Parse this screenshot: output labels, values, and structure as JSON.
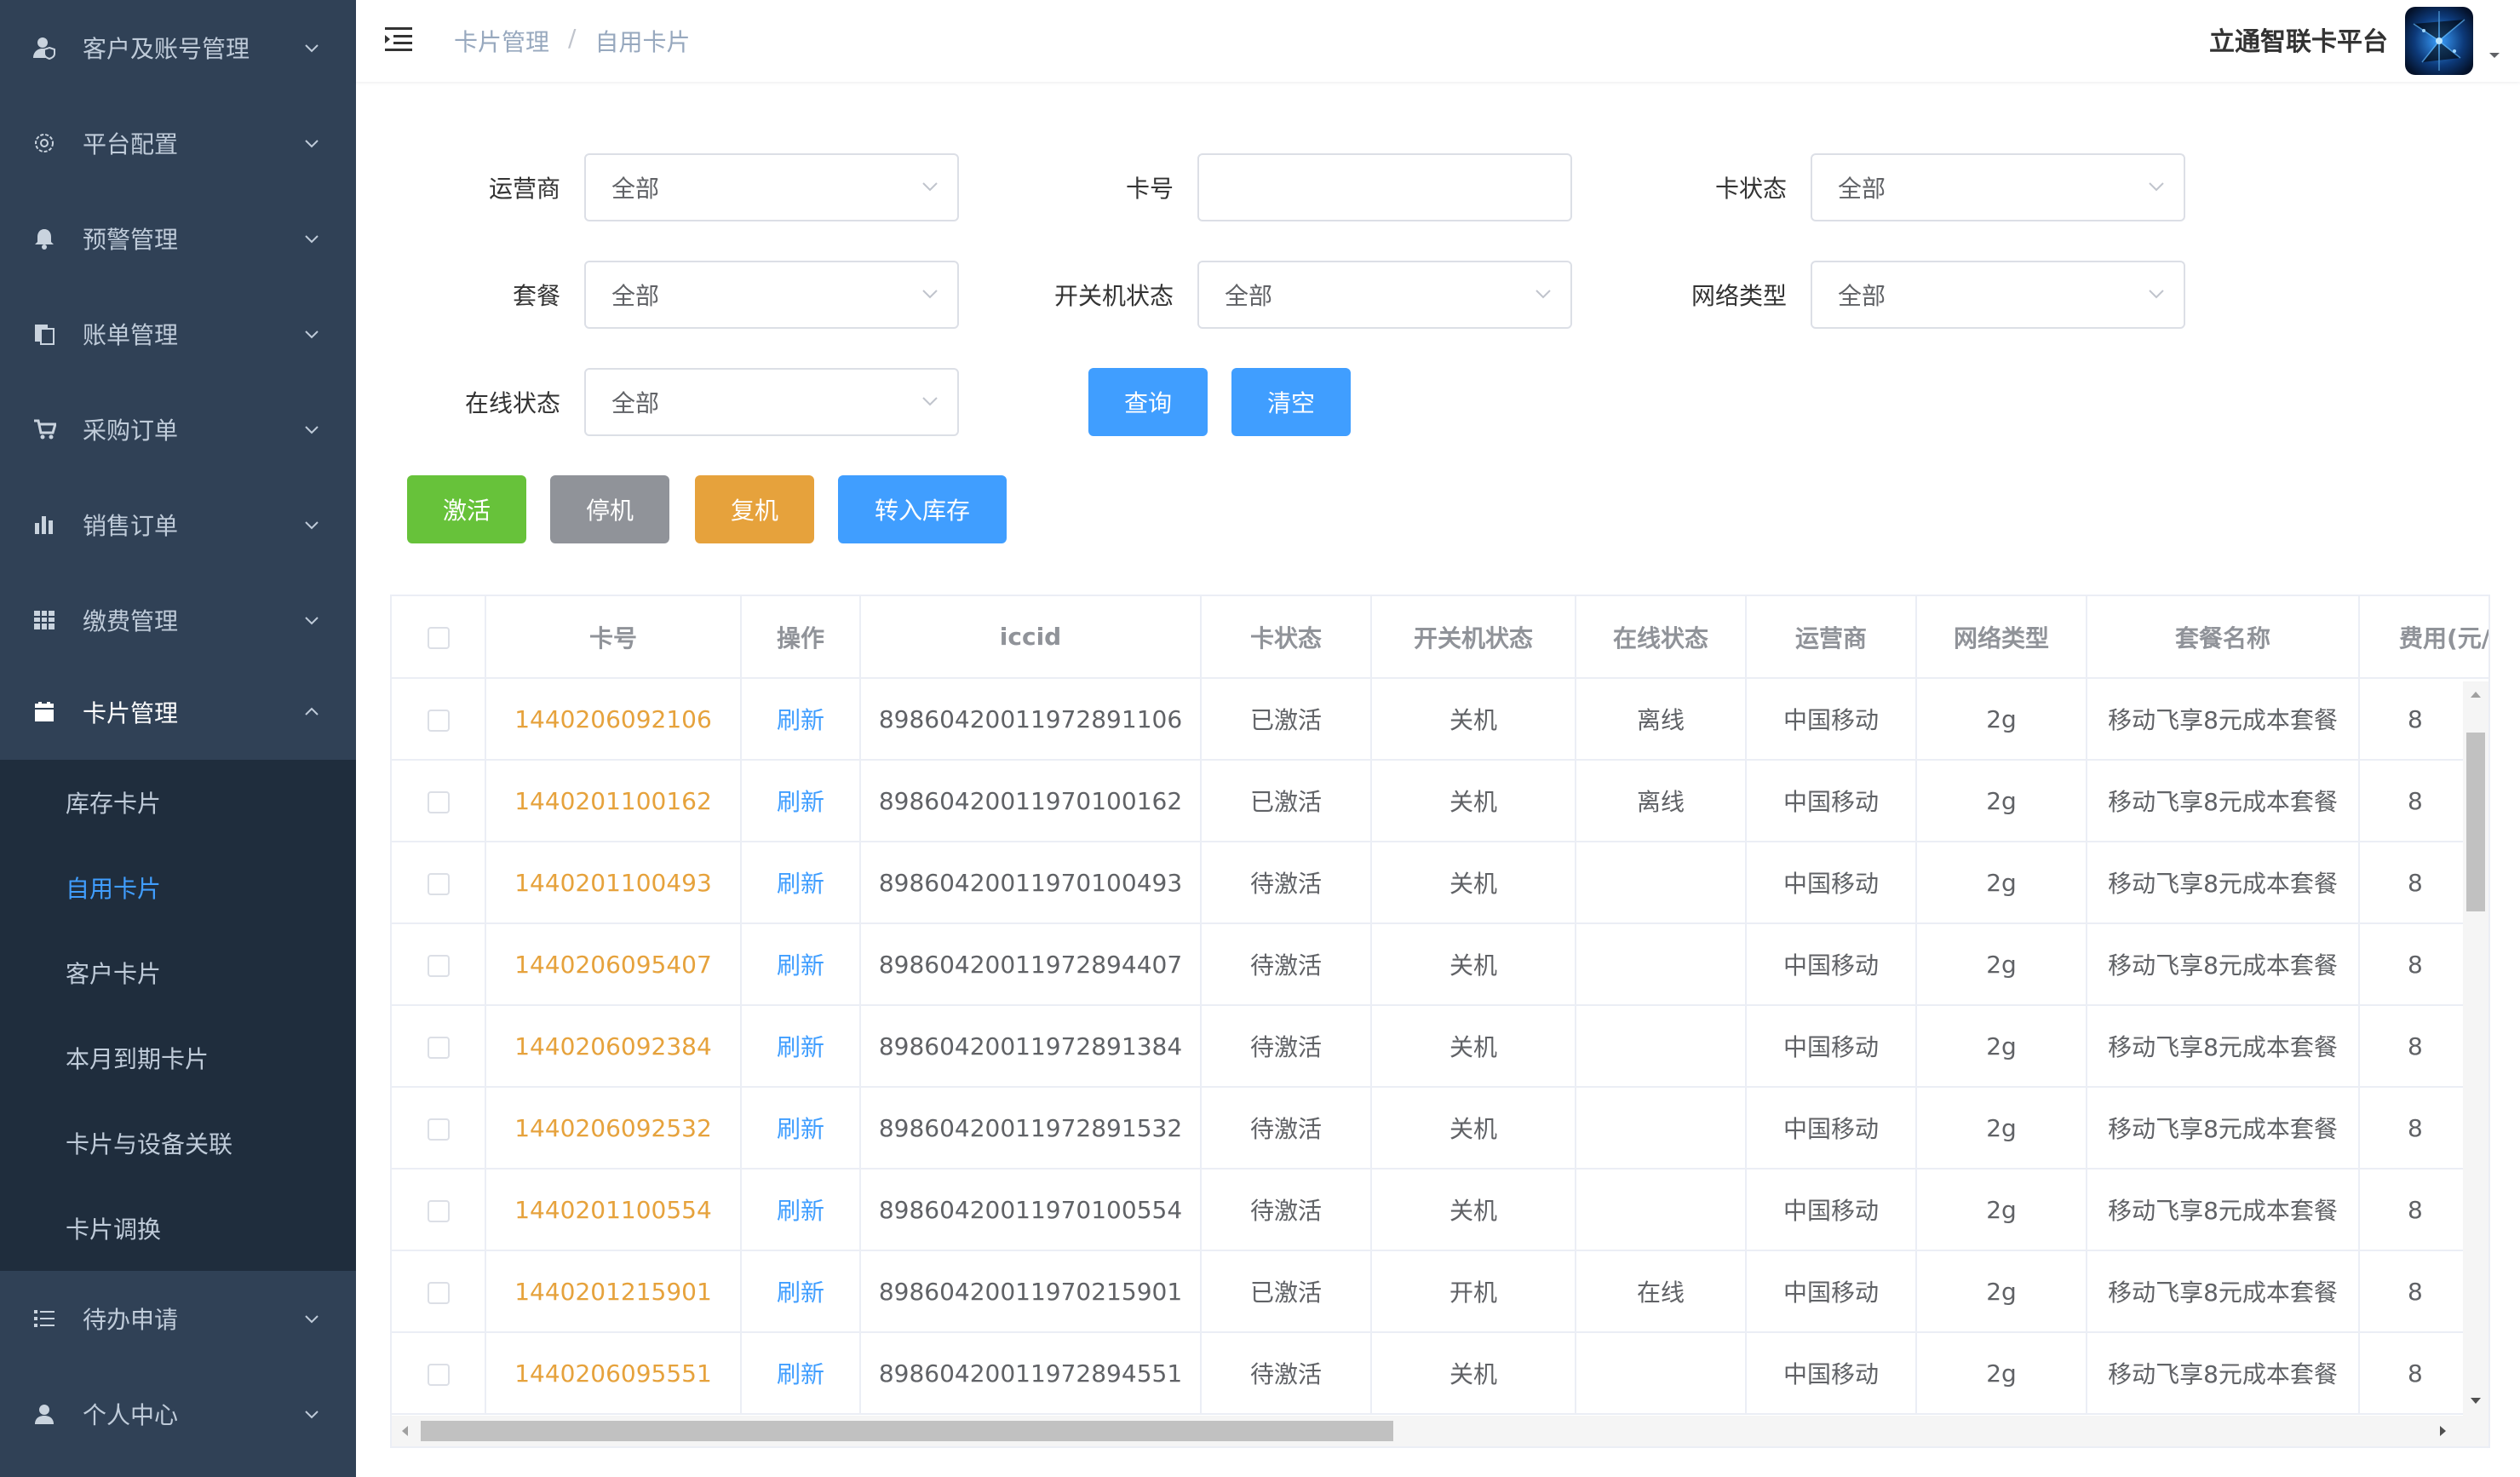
{
  "sidebar": {
    "menu": [
      {
        "label": "客户及账号管理",
        "icon": "user-shield-icon"
      },
      {
        "label": "平台配置",
        "icon": "gear-icon"
      },
      {
        "label": "预警管理",
        "icon": "bell-icon"
      },
      {
        "label": "账单管理",
        "icon": "document-icon"
      },
      {
        "label": "采购订单",
        "icon": "cart-icon"
      },
      {
        "label": "销售订单",
        "icon": "bar-chart-icon"
      },
      {
        "label": "缴费管理",
        "icon": "grid-icon"
      },
      {
        "label": "卡片管理",
        "icon": "folder-icon"
      },
      {
        "label": "待办申请",
        "icon": "list-icon"
      },
      {
        "label": "个人中心",
        "icon": "person-icon"
      }
    ],
    "submenu": [
      {
        "label": "库存卡片"
      },
      {
        "label": "自用卡片"
      },
      {
        "label": "客户卡片"
      },
      {
        "label": "本月到期卡片"
      },
      {
        "label": "卡片与设备关联"
      },
      {
        "label": "卡片调换"
      }
    ],
    "active_sub": "自用卡片"
  },
  "header": {
    "breadcrumb": [
      "卡片管理",
      "/",
      "自用卡片"
    ],
    "brand": "立通智联卡平台"
  },
  "filters": {
    "operator": {
      "label": "运营商",
      "value": "全部"
    },
    "card_no": {
      "label": "卡号",
      "value": "",
      "placeholder": ""
    },
    "card_status": {
      "label": "卡状态",
      "value": "全部"
    },
    "package": {
      "label": "套餐",
      "value": "全部"
    },
    "power_status": {
      "label": "开关机状态",
      "value": "全部"
    },
    "network_type": {
      "label": "网络类型",
      "value": "全部"
    },
    "online_status": {
      "label": "在线状态",
      "value": "全部"
    },
    "query_button": "查询",
    "clear_button": "清空"
  },
  "actions": {
    "activate": "激活",
    "suspend": "停机",
    "resume": "复机",
    "to_stock": "转入库存"
  },
  "colors": {
    "sidebar_bg": "#304156",
    "submenu_bg": "#1f2d3d",
    "primary": "#409eff",
    "success": "#67c23a",
    "info": "#909399",
    "warning": "#e6a23c"
  },
  "table": {
    "columns": [
      "卡号",
      "操作",
      "iccid",
      "卡状态",
      "开关机状态",
      "在线状态",
      "运营商",
      "网络类型",
      "套餐名称",
      "费用(元/"
    ],
    "rows": [
      {
        "card_no": "1440206092106",
        "action": "刷新",
        "iccid": "89860420011972891106",
        "card_status": "已激活",
        "power": "关机",
        "online": "离线",
        "operator": "中国移动",
        "network": "2g",
        "package": "移动飞享8元成本套餐",
        "fee": "8"
      },
      {
        "card_no": "1440201100162",
        "action": "刷新",
        "iccid": "89860420011970100162",
        "card_status": "已激活",
        "power": "关机",
        "online": "离线",
        "operator": "中国移动",
        "network": "2g",
        "package": "移动飞享8元成本套餐",
        "fee": "8"
      },
      {
        "card_no": "1440201100493",
        "action": "刷新",
        "iccid": "89860420011970100493",
        "card_status": "待激活",
        "power": "关机",
        "online": "",
        "operator": "中国移动",
        "network": "2g",
        "package": "移动飞享8元成本套餐",
        "fee": "8"
      },
      {
        "card_no": "1440206095407",
        "action": "刷新",
        "iccid": "89860420011972894407",
        "card_status": "待激活",
        "power": "关机",
        "online": "",
        "operator": "中国移动",
        "network": "2g",
        "package": "移动飞享8元成本套餐",
        "fee": "8"
      },
      {
        "card_no": "1440206092384",
        "action": "刷新",
        "iccid": "89860420011972891384",
        "card_status": "待激活",
        "power": "关机",
        "online": "",
        "operator": "中国移动",
        "network": "2g",
        "package": "移动飞享8元成本套餐",
        "fee": "8"
      },
      {
        "card_no": "1440206092532",
        "action": "刷新",
        "iccid": "89860420011972891532",
        "card_status": "待激活",
        "power": "关机",
        "online": "",
        "operator": "中国移动",
        "network": "2g",
        "package": "移动飞享8元成本套餐",
        "fee": "8"
      },
      {
        "card_no": "1440201100554",
        "action": "刷新",
        "iccid": "89860420011970100554",
        "card_status": "待激活",
        "power": "关机",
        "online": "",
        "operator": "中国移动",
        "network": "2g",
        "package": "移动飞享8元成本套餐",
        "fee": "8"
      },
      {
        "card_no": "1440201215901",
        "action": "刷新",
        "iccid": "89860420011970215901",
        "card_status": "已激活",
        "power": "开机",
        "online": "在线",
        "operator": "中国移动",
        "network": "2g",
        "package": "移动飞享8元成本套餐",
        "fee": "8"
      },
      {
        "card_no": "1440206095551",
        "action": "刷新",
        "iccid": "89860420011972894551",
        "card_status": "待激活",
        "power": "关机",
        "online": "",
        "operator": "中国移动",
        "network": "2g",
        "package": "移动飞享8元成本套餐",
        "fee": "8"
      }
    ]
  }
}
